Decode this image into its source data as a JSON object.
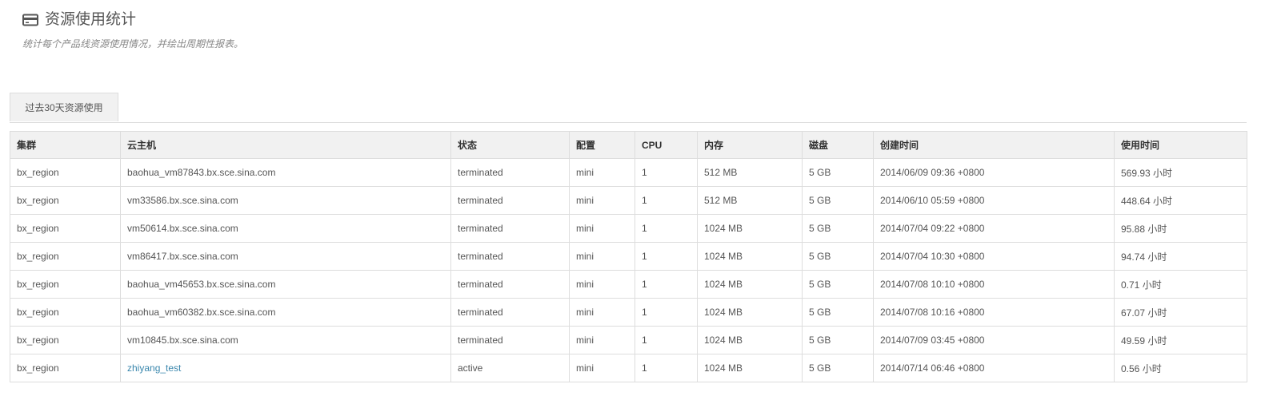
{
  "header": {
    "icon": "credit-card-icon",
    "title": "资源使用统计",
    "subtitle": "统计每个产品线资源使用情况，并绘出周期性报表。"
  },
  "tabs": [
    {
      "label": "过去30天资源使用"
    }
  ],
  "table": {
    "columns": [
      "集群",
      "云主机",
      "状态",
      "配置",
      "CPU",
      "内存",
      "磁盘",
      "创建时间",
      "使用时间"
    ],
    "rows": [
      {
        "cluster": "bx_region",
        "vm": "baohua_vm87843.bx.sce.sina.com",
        "status": "terminated",
        "config": "mini",
        "cpu": "1",
        "memory": "512 MB",
        "disk": "5 GB",
        "created": "2014/06/09 09:36 +0800",
        "usage": "569.93 小时"
      },
      {
        "cluster": "bx_region",
        "vm": "vm33586.bx.sce.sina.com",
        "status": "terminated",
        "config": "mini",
        "cpu": "1",
        "memory": "512 MB",
        "disk": "5 GB",
        "created": "2014/06/10 05:59 +0800",
        "usage": "448.64 小时"
      },
      {
        "cluster": "bx_region",
        "vm": "vm50614.bx.sce.sina.com",
        "status": "terminated",
        "config": "mini",
        "cpu": "1",
        "memory": "1024 MB",
        "disk": "5 GB",
        "created": "2014/07/04 09:22 +0800",
        "usage": "95.88 小时"
      },
      {
        "cluster": "bx_region",
        "vm": "vm86417.bx.sce.sina.com",
        "status": "terminated",
        "config": "mini",
        "cpu": "1",
        "memory": "1024 MB",
        "disk": "5 GB",
        "created": "2014/07/04 10:30 +0800",
        "usage": "94.74 小时"
      },
      {
        "cluster": "bx_region",
        "vm": "baohua_vm45653.bx.sce.sina.com",
        "status": "terminated",
        "config": "mini",
        "cpu": "1",
        "memory": "1024 MB",
        "disk": "5 GB",
        "created": "2014/07/08 10:10 +0800",
        "usage": "0.71 小时"
      },
      {
        "cluster": "bx_region",
        "vm": "baohua_vm60382.bx.sce.sina.com",
        "status": "terminated",
        "config": "mini",
        "cpu": "1",
        "memory": "1024 MB",
        "disk": "5 GB",
        "created": "2014/07/08 10:16 +0800",
        "usage": "67.07 小时"
      },
      {
        "cluster": "bx_region",
        "vm": "vm10845.bx.sce.sina.com",
        "status": "terminated",
        "config": "mini",
        "cpu": "1",
        "memory": "1024 MB",
        "disk": "5 GB",
        "created": "2014/07/09 03:45 +0800",
        "usage": "49.59 小时"
      },
      {
        "cluster": "bx_region",
        "vm": "zhiyang_test",
        "vm_is_link": true,
        "status": "active",
        "config": "mini",
        "cpu": "1",
        "memory": "1024 MB",
        "disk": "5 GB",
        "created": "2014/07/14 06:46 +0800",
        "usage": "0.56 小时"
      }
    ]
  },
  "colors": {
    "link": "#3a87ad",
    "header_bg": "#f1f1f1",
    "border": "#dddddd"
  }
}
